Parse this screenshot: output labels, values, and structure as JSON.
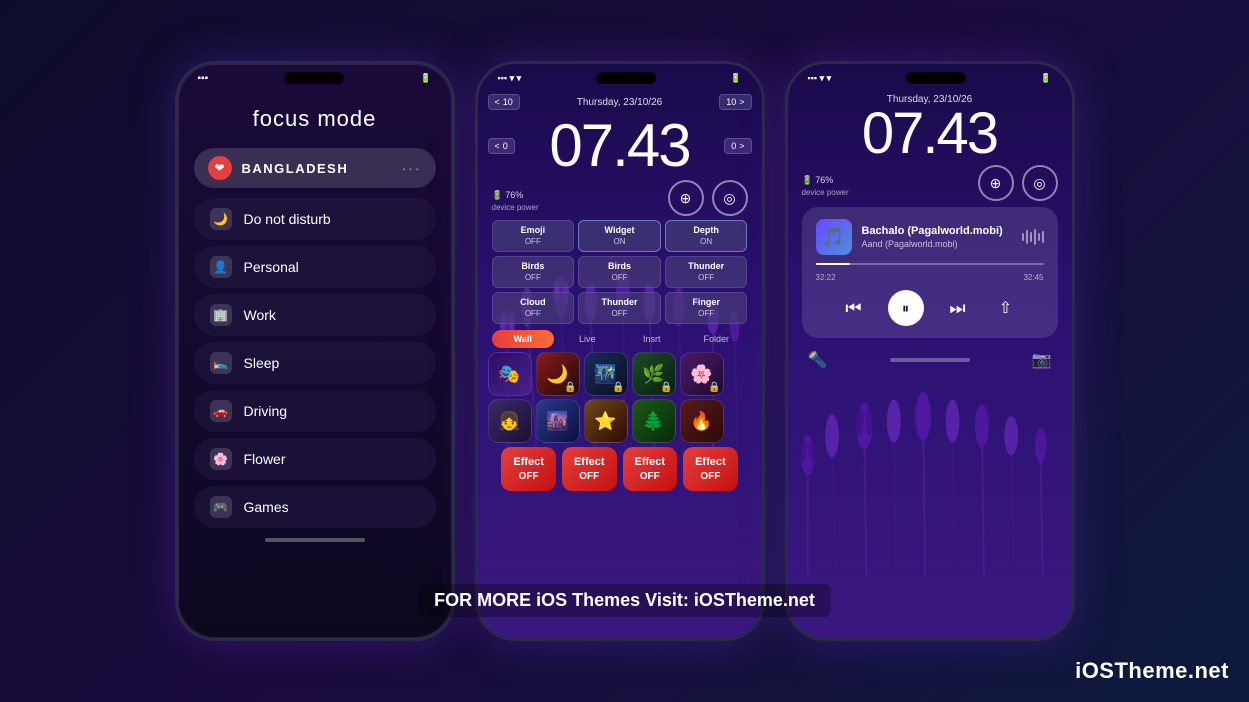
{
  "background": {
    "color": "#0a0a1a"
  },
  "watermark": {
    "bottom_right": "iOSTheme.net",
    "center": "FOR MORE iOS Themes Visit: iOSTheme.net"
  },
  "phone1": {
    "title": "focus mode",
    "active_item": {
      "icon": "❤️",
      "label": "BANGLADESH",
      "dots": "···"
    },
    "menu_items": [
      {
        "icon": "🌙",
        "label": "Do not disturb"
      },
      {
        "icon": "👤",
        "label": "Personal"
      },
      {
        "icon": "🏢",
        "label": "Work"
      },
      {
        "icon": "🛌",
        "label": "Sleep"
      },
      {
        "icon": "🚗",
        "label": "Driving"
      },
      {
        "icon": "🌸",
        "label": "Flower"
      },
      {
        "icon": "🎮",
        "label": "Games"
      }
    ]
  },
  "phone2": {
    "date": "Thursday, 23/10/26",
    "time": "07.43",
    "battery": "76%",
    "battery_label": "device power",
    "effects": [
      {
        "name": "Emoji",
        "status": "OFF"
      },
      {
        "name": "Widget",
        "status": "ON"
      },
      {
        "name": "Depth",
        "status": "ON"
      },
      {
        "name": "Birds",
        "status": "OFF"
      },
      {
        "name": "Birds",
        "status": "OFF"
      },
      {
        "name": "Thunder",
        "status": "OFF"
      },
      {
        "name": "Cloud",
        "status": "OFF"
      },
      {
        "name": "Thunder",
        "status": "OFF"
      },
      {
        "name": "Finger",
        "status": "OFF"
      }
    ],
    "tabs": [
      "Wall",
      "Live",
      "Insrt",
      "Folder"
    ],
    "active_tab": "Wall",
    "effect_bottom": [
      {
        "label": "Effect",
        "status": "OFF"
      },
      {
        "label": "Effect",
        "status": "OFF"
      },
      {
        "label": "Effect",
        "status": "OFF"
      },
      {
        "label": "Effect",
        "status": "OFF"
      }
    ]
  },
  "phone3": {
    "date": "Thursday, 23/10/26",
    "time": "07.43",
    "battery": "76%",
    "battery_label": "device power",
    "now_playing": {
      "song": "Bachalo (Pagalworld.mobi)",
      "artist": "Aand (Pagalworld.mobi)",
      "time_current": "32:22",
      "time_total": "32:45",
      "progress": 15
    }
  }
}
